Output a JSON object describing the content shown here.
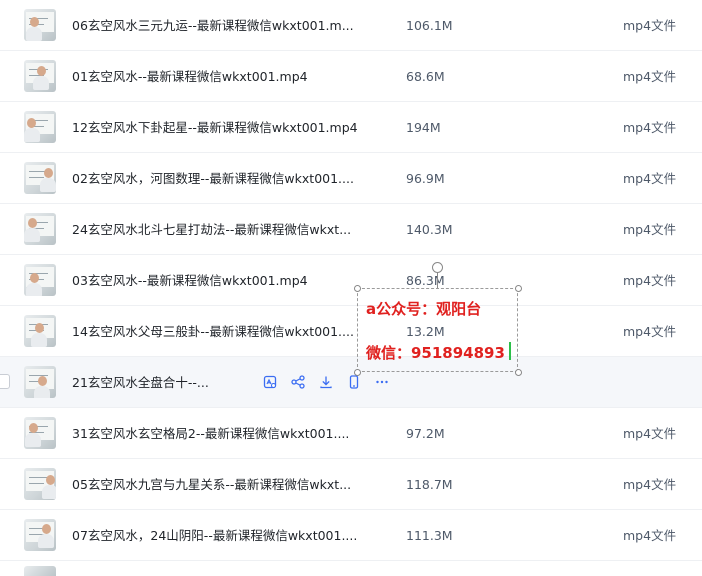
{
  "files": [
    {
      "name": "06玄空风水三元九运--最新课程微信wkxt001.m...",
      "size": "106.1M",
      "type": "mp4文件"
    },
    {
      "name": "01玄空风水--最新课程微信wkxt001.mp4",
      "size": "68.6M",
      "type": "mp4文件"
    },
    {
      "name": "12玄空风水下卦起星--最新课程微信wkxt001.mp4",
      "size": "194M",
      "type": "mp4文件"
    },
    {
      "name": "02玄空风水，河图数理--最新课程微信wkxt001....",
      "size": "96.9M",
      "type": "mp4文件"
    },
    {
      "name": "24玄空风水北斗七星打劫法--最新课程微信wkxt...",
      "size": "140.3M",
      "type": "mp4文件"
    },
    {
      "name": "03玄空风水--最新课程微信wkxt001.mp4",
      "size": "86.3M",
      "type": "mp4文件"
    },
    {
      "name": "14玄空风水父母三般卦--最新课程微信wkxt001....",
      "size": "13.2M",
      "type": "mp4文件"
    },
    {
      "name": "21玄空风水全盘合十--...",
      "size": "",
      "type": ""
    },
    {
      "name": "31玄空风水玄空格局2--最新课程微信wkxt001....",
      "size": "97.2M",
      "type": "mp4文件"
    },
    {
      "name": "05玄空风水九宫与九星关系--最新课程微信wkxt...",
      "size": "118.7M",
      "type": "mp4文件"
    },
    {
      "name": "07玄空风水，24山阴阳--最新课程微信wkxt001....",
      "size": "111.3M",
      "type": "mp4文件"
    }
  ],
  "row_actions": [
    "save-icon",
    "share-icon",
    "download-icon",
    "phone-icon",
    "more-icon"
  ],
  "overlay": {
    "line1": "a公众号：观阳台",
    "line2": "微信：951894893"
  },
  "colors": {
    "overlay_text": "#e0211f",
    "cursor": "#2cbf4a",
    "hover_row": "#f5f7fa"
  }
}
